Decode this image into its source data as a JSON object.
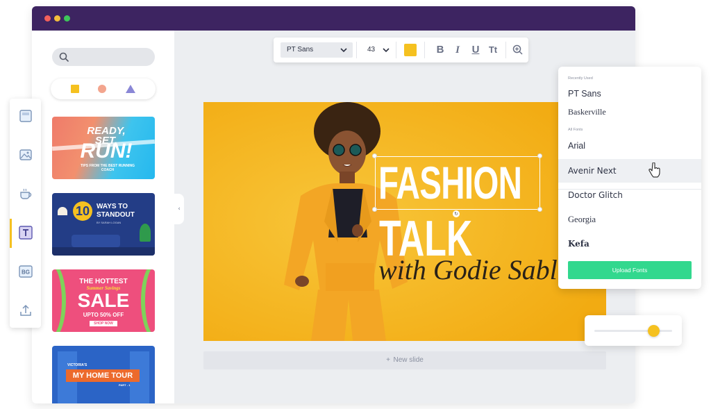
{
  "colors": {
    "titlebar": "#3d2461",
    "accent_yellow": "#f5c120",
    "canvas_bg": "#f5b71b",
    "upload_button": "#32d88e",
    "shape_square": "#f5c120",
    "shape_circle": "#f3a58e",
    "shape_triangle": "#8a87d6"
  },
  "window_controls": [
    "close-dot",
    "minimize-dot",
    "zoom-dot"
  ],
  "sidebar": {
    "search_icon": "search-icon",
    "shapes": [
      "square",
      "circle",
      "triangle"
    ],
    "templates": [
      {
        "name": "ready-set-run",
        "line1": "READY, SET,",
        "line2": "RUN!",
        "small": "TIPS FROM THE BEST RUNNING COACH"
      },
      {
        "name": "10-ways-to-standout",
        "number": "10",
        "line1": "WAYS TO",
        "line2": "STANDOUT",
        "sub": "BY SARAH LOGAN"
      },
      {
        "name": "the-hottest-sale",
        "line1": "THE HOTTEST",
        "line2": "Summer Savings",
        "line3": "SALE",
        "line4": "UPTO 50% OFF",
        "cta": "SHOP NOW"
      },
      {
        "name": "my-home-tour",
        "line1": "VICTORIA'S",
        "line2": "MY HOME TOUR",
        "line3": "PART - 1"
      }
    ],
    "collapse_icon": "‹"
  },
  "iconbar": {
    "items": [
      {
        "name": "templates-icon",
        "active": false
      },
      {
        "name": "images-icon",
        "active": false
      },
      {
        "name": "icons-icon",
        "active": false
      },
      {
        "name": "text-icon",
        "active": true
      },
      {
        "name": "background-icon",
        "label": "BG",
        "active": false
      },
      {
        "name": "upload-icon",
        "active": false
      }
    ]
  },
  "toolbar": {
    "font": "PT Sans",
    "size": "43",
    "color": "#f5c120",
    "buttons": [
      "B",
      "I",
      "U",
      "Tt"
    ],
    "zoom_icon": "zoom-in-icon"
  },
  "canvas": {
    "headline1": "FASHION",
    "headline2": "TALK",
    "script": "with Godie Sable",
    "rotate_glyph": "↻"
  },
  "new_slide": {
    "plus": "+",
    "label": "New slide"
  },
  "font_menu": {
    "recent_label": "Recently Used",
    "recent": [
      "PT Sans",
      "Baskerville"
    ],
    "all_label": "All Fonts",
    "all": [
      "Arial",
      "Avenir Next",
      "Doctor Glitch",
      "Georgia",
      "Kefa"
    ],
    "hovered": "Avenir Next",
    "upload_label": "Upload Fonts"
  },
  "slider": {
    "value": 0.76
  }
}
